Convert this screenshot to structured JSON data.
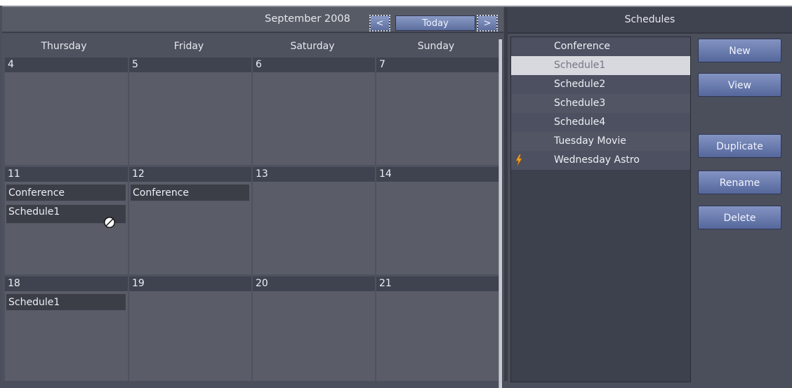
{
  "calendar": {
    "month_label": "September 2008",
    "prev_label": "<",
    "today_label": "Today",
    "next_label": ">",
    "day_names": [
      "Thursday",
      "Friday",
      "Saturday",
      "Sunday"
    ],
    "weeks": [
      {
        "days": [
          {
            "date": "4",
            "events": []
          },
          {
            "date": "5",
            "events": []
          },
          {
            "date": "6",
            "events": []
          },
          {
            "date": "7",
            "events": []
          }
        ]
      },
      {
        "days": [
          {
            "date": "11",
            "events": [
              "Conference",
              "Schedule1"
            ]
          },
          {
            "date": "12",
            "events": [
              "Conference"
            ]
          },
          {
            "date": "13",
            "events": []
          },
          {
            "date": "14",
            "events": []
          }
        ]
      },
      {
        "days": [
          {
            "date": "18",
            "events": [
              "Schedule1"
            ]
          },
          {
            "date": "19",
            "events": []
          },
          {
            "date": "20",
            "events": []
          },
          {
            "date": "21",
            "events": []
          }
        ]
      }
    ]
  },
  "schedules": {
    "title": "Schedules",
    "items": [
      {
        "label": "Conference",
        "state": "plain"
      },
      {
        "label": "Schedule1",
        "state": "selected"
      },
      {
        "label": "Schedule2",
        "state": "plain"
      },
      {
        "label": "Schedule3",
        "state": "alt"
      },
      {
        "label": "Schedule4",
        "state": "plain"
      },
      {
        "label": "Tuesday Movie",
        "state": "alt"
      },
      {
        "label": "Wednesday Astro",
        "state": "plain",
        "icon": "lightning-bolt-icon"
      }
    ],
    "buttons": {
      "new": "New",
      "view": "View",
      "duplicate": "Duplicate",
      "rename": "Rename",
      "delete": "Delete"
    }
  },
  "colors": {
    "button_gradient_top": "#8a9ac6",
    "button_gradient_bottom": "#5d6f9e",
    "selected_row": "#d8d9de",
    "bolt": "#f0a020"
  }
}
